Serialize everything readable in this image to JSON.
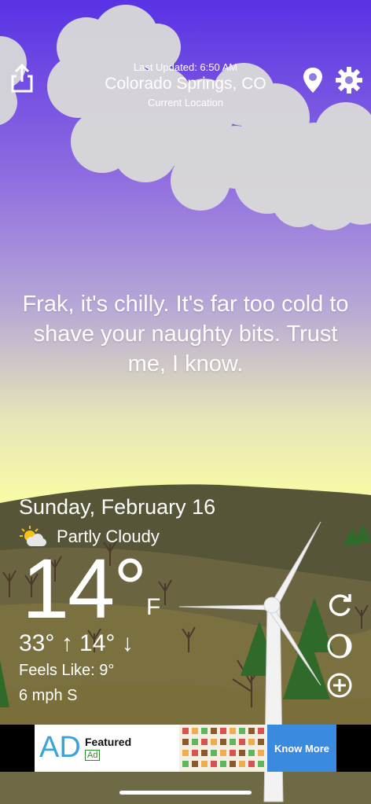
{
  "header": {
    "last_updated": "Last Updated: 6:50 AM",
    "location": "Colorado Springs, CO",
    "location_sub": "Current Location"
  },
  "quip": "Frak, it's chilly. It's far too cold to shave your naughty bits. Trust me, I know.",
  "weather": {
    "date": "Sunday, February 16",
    "condition": "Partly Cloudy",
    "temp": "14°",
    "unit": "F",
    "hilo": "33° ↑ 14° ↓",
    "feels_like": "Feels Like: 9°",
    "wind": "6 mph S"
  },
  "ad": {
    "logo": "AD",
    "title": "Featured",
    "badge": "Ad",
    "cta": "Know More"
  },
  "colors": {
    "sky_top": "#5b35e0",
    "sky_mid": "#a79ad6",
    "sky_horizon": "#f7f9a8",
    "hill": "#5e5a3e",
    "ad_cta": "#3a8be0"
  },
  "icons": [
    "share-icon",
    "location-pin-icon",
    "settings-gear-icon",
    "partly-cloudy-icon",
    "refresh-icon",
    "moon-phase-icon",
    "add-location-icon"
  ]
}
